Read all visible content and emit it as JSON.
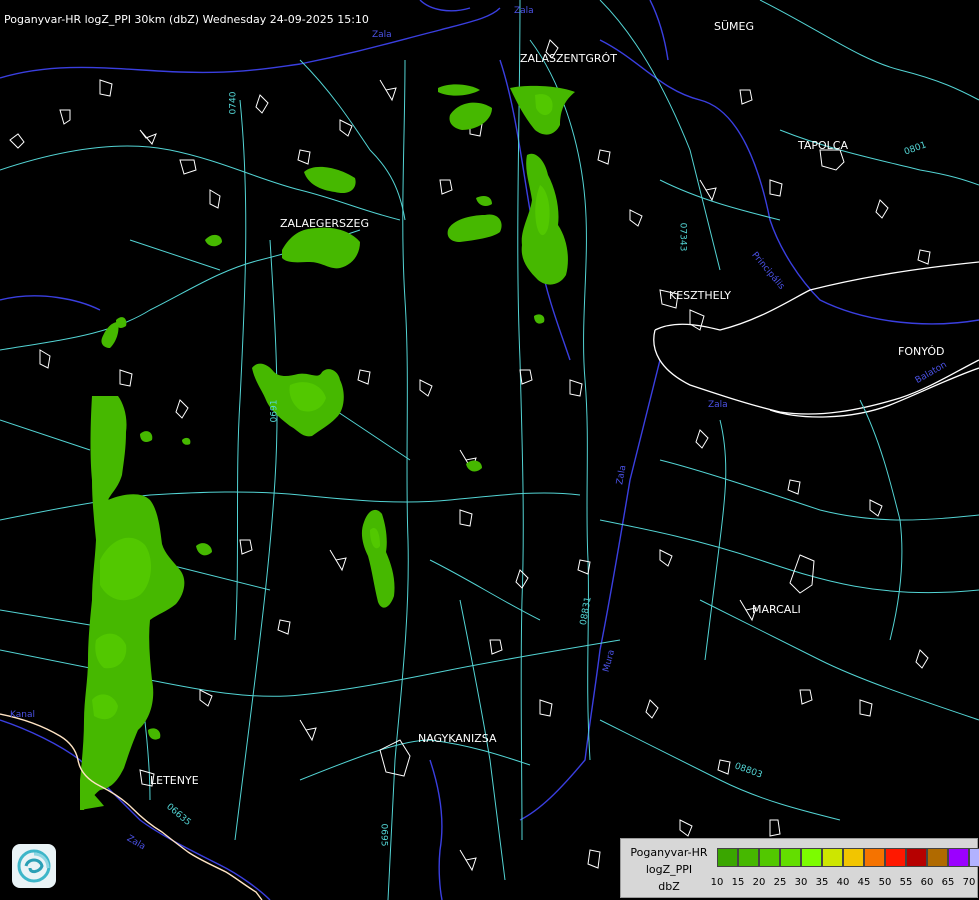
{
  "title": "Poganyvar-HR logZ_PPI 30km (dbZ) Wednesday 24-09-2025 15:10",
  "cities": [
    "SÜMEG",
    "ZALASZENTGRÓT",
    "TAPOLCA",
    "ZALAEGERSZEG",
    "KESZTHELY",
    "FONYÓD",
    "MARCALI",
    "NAGYKANIZSA",
    "LETENYE"
  ],
  "roads": [
    "0740",
    "07343",
    "0691",
    "08831",
    "08803",
    "06635",
    "0695",
    "0801"
  ],
  "rivers": [
    "Zala",
    "Zala",
    "Zala",
    "Balaton",
    "Principális",
    "Mura",
    "Zala",
    "Zala",
    "Kanal"
  ],
  "legend": {
    "title_lines": [
      "Poganyvar-HR",
      "logZ_PPI",
      "dbZ"
    ],
    "ticks": [
      "10",
      "15",
      "20",
      "25",
      "30",
      "35",
      "40",
      "45",
      "50",
      "55",
      "60",
      "65",
      "70"
    ],
    "colors": [
      "#3aa600",
      "#46b800",
      "#52c800",
      "#63de00",
      "#7cfc00",
      "#cde600",
      "#f2c500",
      "#f57300",
      "#ff1800",
      "#b60000",
      "#b06a00",
      "#9b00ff",
      "#b2b2ff"
    ]
  },
  "colors": {
    "roads": "#53d4d4",
    "rivers": "#3a3fe0",
    "borders": "#ffffff",
    "background": "#000000"
  }
}
